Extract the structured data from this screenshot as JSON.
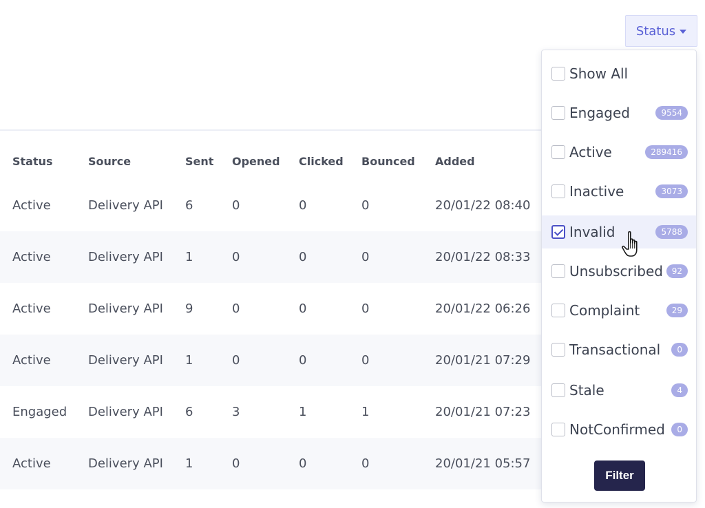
{
  "status_button": {
    "label": "Status"
  },
  "table": {
    "columns": [
      "Status",
      "Source",
      "Sent",
      "Opened",
      "Clicked",
      "Bounced",
      "Added"
    ],
    "rows": [
      [
        "Active",
        "Delivery API",
        "6",
        "0",
        "0",
        "0",
        "20/01/22 08:40"
      ],
      [
        "Active",
        "Delivery API",
        "1",
        "0",
        "0",
        "0",
        "20/01/22 08:33"
      ],
      [
        "Active",
        "Delivery API",
        "9",
        "0",
        "0",
        "0",
        "20/01/22 06:26"
      ],
      [
        "Active",
        "Delivery API",
        "1",
        "0",
        "0",
        "0",
        "20/01/21 07:29"
      ],
      [
        "Engaged",
        "Delivery API",
        "6",
        "3",
        "1",
        "1",
        "20/01/21 07:23"
      ],
      [
        "Active",
        "Delivery API",
        "1",
        "0",
        "0",
        "0",
        "20/01/21 05:57"
      ]
    ]
  },
  "filter_panel": {
    "options": [
      {
        "label": "Show All",
        "count": "",
        "checked": false
      },
      {
        "label": "Engaged",
        "count": "9554",
        "checked": false
      },
      {
        "label": "Active",
        "count": "289416",
        "checked": false
      },
      {
        "label": "Inactive",
        "count": "3073",
        "checked": false
      },
      {
        "label": "Invalid",
        "count": "5788",
        "checked": true
      },
      {
        "label": "Unsubscribed",
        "count": "92",
        "checked": false
      },
      {
        "label": "Complaint",
        "count": "29",
        "checked": false
      },
      {
        "label": "Transactional",
        "count": "0",
        "checked": false
      },
      {
        "label": "Stale",
        "count": "4",
        "checked": false
      },
      {
        "label": "NotConfirmed",
        "count": "0",
        "checked": false
      }
    ],
    "filter_button": "Filter"
  },
  "colors": {
    "accent": "#5a61d6",
    "badge": "#a9ace6",
    "filter_button_bg": "#25254c",
    "row_alt": "#f7f8fb"
  },
  "icons": {
    "status_caret": "caret-down-icon",
    "cursor": "hand-pointer-icon"
  }
}
